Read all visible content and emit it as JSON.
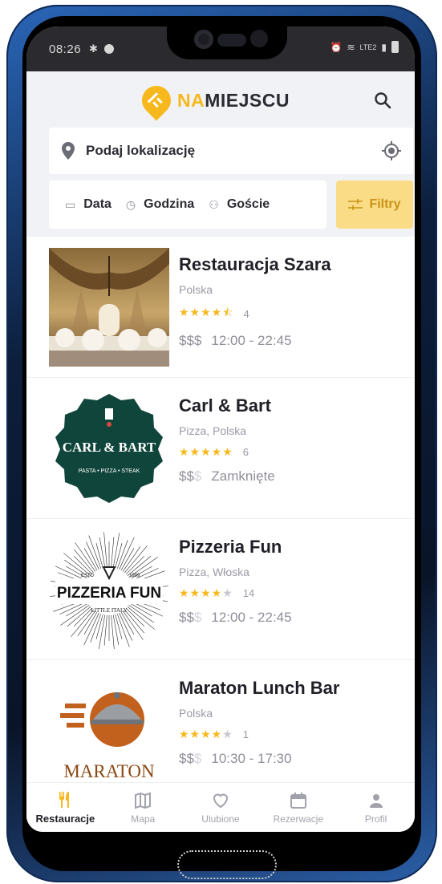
{
  "status_bar": {
    "time": "08:26",
    "network_label": "LTE2"
  },
  "header": {
    "logo_part1": "NA",
    "logo_part2": "MIEJSCU"
  },
  "location": {
    "placeholder": "Podaj lokalizację"
  },
  "filters": {
    "date": "Data",
    "time": "Godzina",
    "guests": "Goście",
    "filters_button": "Filtry"
  },
  "colors": {
    "accent": "#f6b81c",
    "filters_bg": "#fbdc86"
  },
  "restaurants": [
    {
      "name": "Restauracja Szara",
      "cuisine": "Polska",
      "rating": 4.5,
      "reviews": "4",
      "price_level": 3,
      "price": "$$$",
      "hours": "12:00 - 22:45"
    },
    {
      "name": "Carl & Bart",
      "cuisine": "Pizza, Polska",
      "rating": 5,
      "reviews": "6",
      "price_level": 2,
      "price": "$$$",
      "hours": "Zamknięte",
      "logo_text_top": "CARL & BART",
      "logo_text_bottom": "PASTA • PIZZA • STEAK"
    },
    {
      "name": "Pizzeria Fun",
      "cuisine": "Pizza, Włoska",
      "rating": 4,
      "reviews": "14",
      "price_level": 2,
      "price": "$$$",
      "hours": "12:00 - 22:45",
      "logo_text_main": "PIZZERIA FUN",
      "logo_text_sub": "LITTLE ITALY",
      "logo_est": "ESTD",
      "logo_year": "1999"
    },
    {
      "name": "Maraton Lunch Bar",
      "cuisine": "Polska",
      "rating": 4,
      "reviews": "1",
      "price_level": 2,
      "price": "$$$",
      "hours": "10:30 - 17:30",
      "logo_text": "MARATON"
    }
  ],
  "nav": {
    "restaurants": "Restauracje",
    "map": "Mapa",
    "favorites": "Ulubione",
    "reservations": "Rezerwacje",
    "profile": "Profil"
  }
}
